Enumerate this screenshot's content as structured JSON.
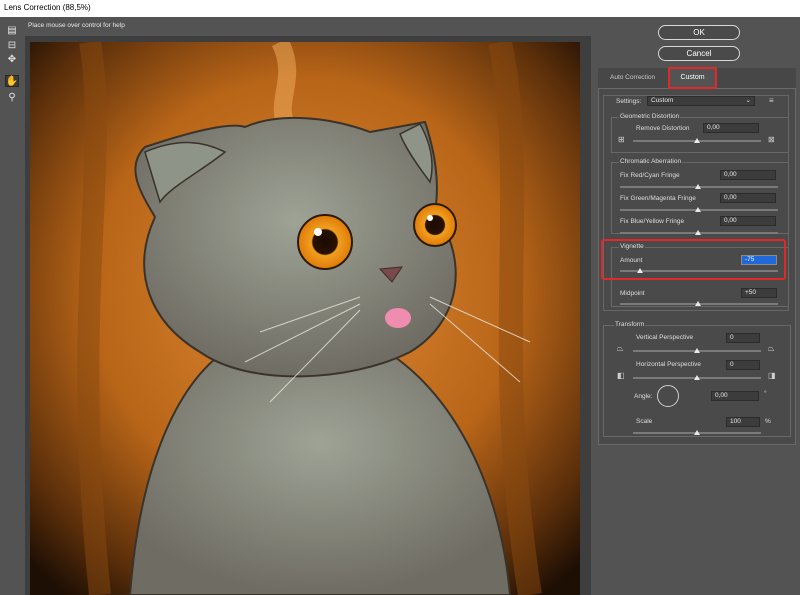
{
  "window": {
    "title": "Lens Correction (88,5%)"
  },
  "help_text": "Place mouse over control for help",
  "buttons": {
    "ok": "OK",
    "cancel": "Cancel"
  },
  "tabs": {
    "auto": "Auto Correction",
    "custom": "Custom",
    "active": "custom"
  },
  "settings": {
    "label": "Settings:",
    "value": "Custom",
    "menu_icon": "panel-menu-icon"
  },
  "geometric": {
    "title": "Geometric Distortion",
    "remove_label": "Remove Distortion",
    "remove_value": "0,00"
  },
  "chromatic": {
    "title": "Chromatic Aberration",
    "red_cyan_label": "Fix Red/Cyan Fringe",
    "red_cyan_value": "0,00",
    "green_magenta_label": "Fix Green/Magenta Fringe",
    "green_magenta_value": "0,00",
    "blue_yellow_label": "Fix Blue/Yellow Fringe",
    "blue_yellow_value": "0,00"
  },
  "vignette": {
    "title": "Vignette",
    "amount_label": "Amount",
    "amount_value": "-75",
    "midpoint_label": "Midpoint",
    "midpoint_value": "+50"
  },
  "transform": {
    "title": "Transform",
    "vertical_label": "Vertical Perspective",
    "vertical_value": "0",
    "horizontal_label": "Horizontal Perspective",
    "horizontal_value": "0",
    "angle_label": "Angle:",
    "angle_value": "0,00",
    "angle_unit": "°",
    "scale_label": "Scale",
    "scale_value": "100",
    "scale_unit": "%"
  },
  "tools": [
    "remove-distortion-tool-icon",
    "straighten-tool-icon",
    "move-grid-tool-icon",
    "hand-tool-icon",
    "zoom-tool-icon"
  ]
}
